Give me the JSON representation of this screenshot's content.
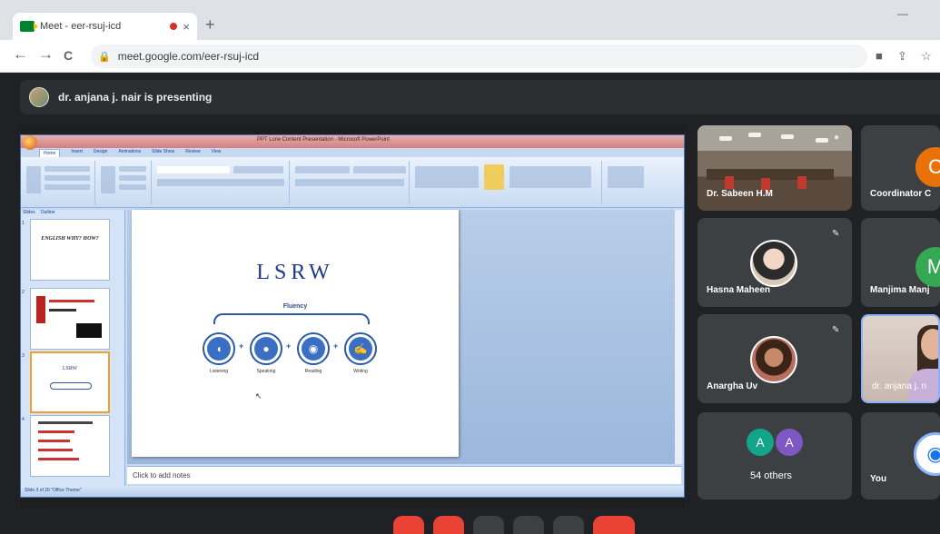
{
  "browser": {
    "tab_title": "Meet - eer-rsuj-icd",
    "tab_close": "×",
    "new_tab": "+",
    "url": "meet.google.com/eer-rsuj-icd",
    "back": "←",
    "forward": "→",
    "reload": "C"
  },
  "meet": {
    "presenting_text": "dr. anjana j. nair is presenting",
    "participants": [
      {
        "name": "Dr. Sabeen H.M"
      },
      {
        "name": "Coordinator C",
        "initial": "C",
        "color": "#e8710a"
      },
      {
        "name": "Hasna Maheen"
      },
      {
        "name": "Manjima Manj",
        "initial": "M",
        "color": "#34a853"
      },
      {
        "name": "Anargha Uv"
      },
      {
        "name": "dr. anjana j. n"
      },
      {
        "name": "54 others",
        "initials": [
          "A",
          "A"
        ],
        "colors": [
          "#12a58a",
          "#7e57c2"
        ]
      },
      {
        "name": "You"
      }
    ]
  },
  "ppt": {
    "window_title": "PPT Lsrw Content Presentation - Microsoft PowerPoint",
    "ribbon_tabs": [
      "Home",
      "Insert",
      "Design",
      "Animations",
      "Slide Show",
      "Review",
      "View"
    ],
    "panel_tabs": [
      "Slides",
      "Outline"
    ],
    "thumbnails": [
      {
        "num": "1",
        "text": "ENGLISH WHY? HOW?"
      },
      {
        "num": "2",
        "text": ""
      },
      {
        "num": "3",
        "text": "LSRW"
      },
      {
        "num": "4",
        "text": ""
      }
    ],
    "slide": {
      "title": "LSRW",
      "subtitle": "Fluency",
      "skills": [
        "Listening",
        "Speaking",
        "Reading",
        "Writing"
      ]
    },
    "notes_placeholder": "Click to add notes",
    "status": "Slide 3 of 20   \"Office Theme\""
  }
}
